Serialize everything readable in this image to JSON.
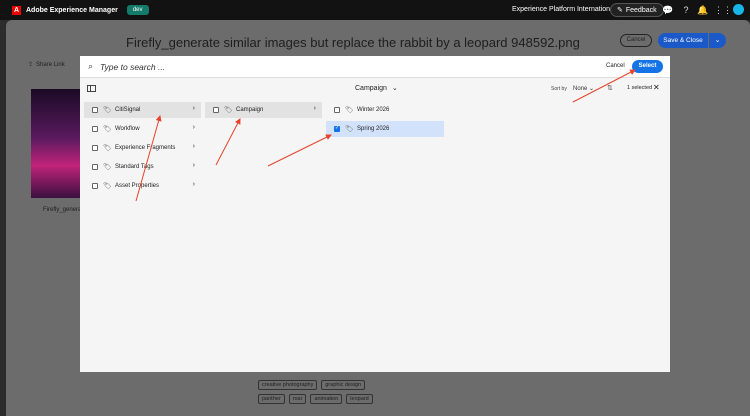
{
  "topbar": {
    "logo_letter": "A",
    "app_title": "Adobe Experience Manager",
    "env_badge": "dev",
    "org_name": "Experience Platform International",
    "feedback_label": "Feedback",
    "icons": [
      "chat-icon",
      "help-icon",
      "bell-icon",
      "apps-grid-icon"
    ]
  },
  "page": {
    "title": "Firefly_generate similar images but replace the rabbit by a leopard 948592.png",
    "cancel_label": "Cancel",
    "save_close_label": "Save & Close",
    "share_link_label": "Share Link",
    "thumb_caption": "Firefly_generat",
    "tags_row1": [
      "creative photography",
      "graphic design"
    ],
    "tags_row2": [
      "panther",
      "roar",
      "animation",
      "leopard"
    ]
  },
  "modal": {
    "search_placeholder": "Type to search ...",
    "cancel_label": "Cancel",
    "select_label": "Select",
    "breadcrumb": "Campaign",
    "sort_by_label": "Sort by",
    "sort_value": "None",
    "selected_count": "1 selected",
    "column1": [
      "CitiSignal",
      "Workflow",
      "Experience Fragments",
      "Standard Tags",
      "Asset Properties"
    ],
    "column2": [
      "Campaign"
    ],
    "column3": [
      "Winter 2026",
      "Spring 2026"
    ]
  },
  "colors": {
    "accent": "#1473e6",
    "save_button": "#1b58c8",
    "annotation_arrow": "#e8422a",
    "env_badge": "#147a6a"
  }
}
